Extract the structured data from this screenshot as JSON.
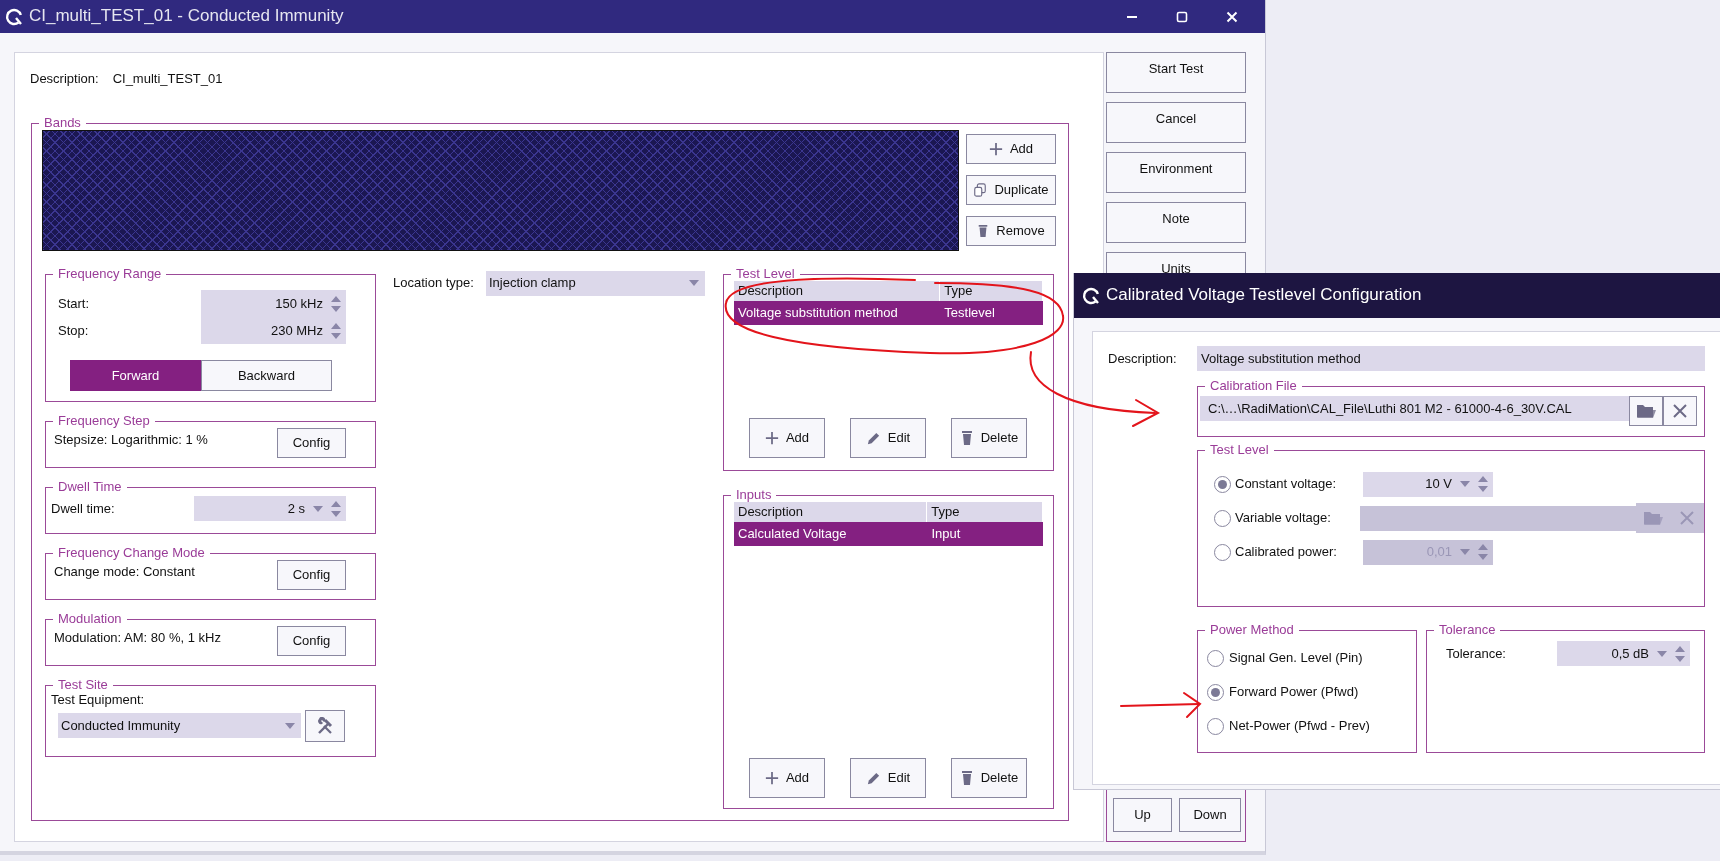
{
  "window": {
    "title": "CI_multi_TEST_01 - Conducted Immunity"
  },
  "description": {
    "label": "Description:",
    "value": "CI_multi_TEST_01"
  },
  "side_buttons": [
    "Start Test",
    "Cancel",
    "Environment",
    "Note",
    "Units"
  ],
  "order_buttons": [
    "Up",
    "Down"
  ],
  "bands": {
    "title": "Bands",
    "buttons": [
      {
        "kind": "add",
        "label": "Add"
      },
      {
        "kind": "duplicate",
        "label": "Duplicate"
      },
      {
        "kind": "remove",
        "label": "Remove"
      }
    ]
  },
  "frequency_range": {
    "title": "Frequency Range",
    "fields": [
      {
        "label": "Start:",
        "value": "150 kHz"
      },
      {
        "label": "Stop:",
        "value": "230 MHz"
      }
    ],
    "directions": [
      {
        "label": "Forward",
        "selected": true
      },
      {
        "label": "Backward",
        "selected": false
      }
    ]
  },
  "frequency_step": {
    "title": "Frequency Step",
    "text": "Stepsize: Logarithmic: 1 %",
    "button": "Config"
  },
  "dwell_time": {
    "title": "Dwell Time",
    "label": "Dwell time:",
    "value": "2 s"
  },
  "frequency_change_mode": {
    "title": "Frequency Change Mode",
    "text": "Change mode: Constant",
    "button": "Config"
  },
  "modulation": {
    "title": "Modulation",
    "text": "Modulation: AM: 80 %, 1 kHz",
    "button": "Config"
  },
  "test_site": {
    "title": "Test Site",
    "label": "Test Equipment:",
    "value": "Conducted Immunity"
  },
  "location_type": {
    "label": "Location type:",
    "value": "Injection clamp"
  },
  "test_level": {
    "title": "Test Level",
    "columns": [
      "Description",
      "Type"
    ],
    "rows": [
      {
        "cells": [
          "Voltage substitution method",
          "Testlevel"
        ],
        "selected": true
      }
    ],
    "buttons": [
      {
        "kind": "add",
        "label": "Add"
      },
      {
        "kind": "edit",
        "label": "Edit"
      },
      {
        "kind": "delete",
        "label": "Delete"
      }
    ]
  },
  "inputs": {
    "title": "Inputs",
    "columns": [
      "Description",
      "Type"
    ],
    "rows": [
      {
        "cells": [
          "Calculated Voltage",
          "Input"
        ],
        "selected": true
      }
    ],
    "buttons": [
      {
        "kind": "add",
        "label": "Add"
      },
      {
        "kind": "edit",
        "label": "Edit"
      },
      {
        "kind": "delete",
        "label": "Delete"
      }
    ]
  },
  "dialog": {
    "title": "Calibrated Voltage Testlevel Configuration",
    "description": {
      "label": "Description:",
      "value": "Voltage substitution method"
    },
    "calibration_file": {
      "title": "Calibration File",
      "value": "C:\\…\\RadiMation\\CAL_File\\Luthi 801 M2 - 61000-4-6_30V.CAL"
    },
    "test_level": {
      "title": "Test Level",
      "options": [
        {
          "kind": "spin",
          "label": "Constant voltage:",
          "value": "10 V",
          "selected": true
        },
        {
          "kind": "file",
          "label": "Variable voltage:",
          "selected": false
        },
        {
          "kind": "spin",
          "label": "Calibrated power:",
          "value": "0,01",
          "selected": false
        }
      ]
    },
    "power_method": {
      "title": "Power Method",
      "options": [
        {
          "label": "Signal Gen. Level (Pin)",
          "selected": false
        },
        {
          "label": "Forward Power (Pfwd)",
          "selected": true
        },
        {
          "label": "Net-Power (Pfwd - Prev)",
          "selected": false
        }
      ]
    },
    "tolerance": {
      "title": "Tolerance",
      "label": "Tolerance:",
      "value": "0,5 dB"
    }
  }
}
